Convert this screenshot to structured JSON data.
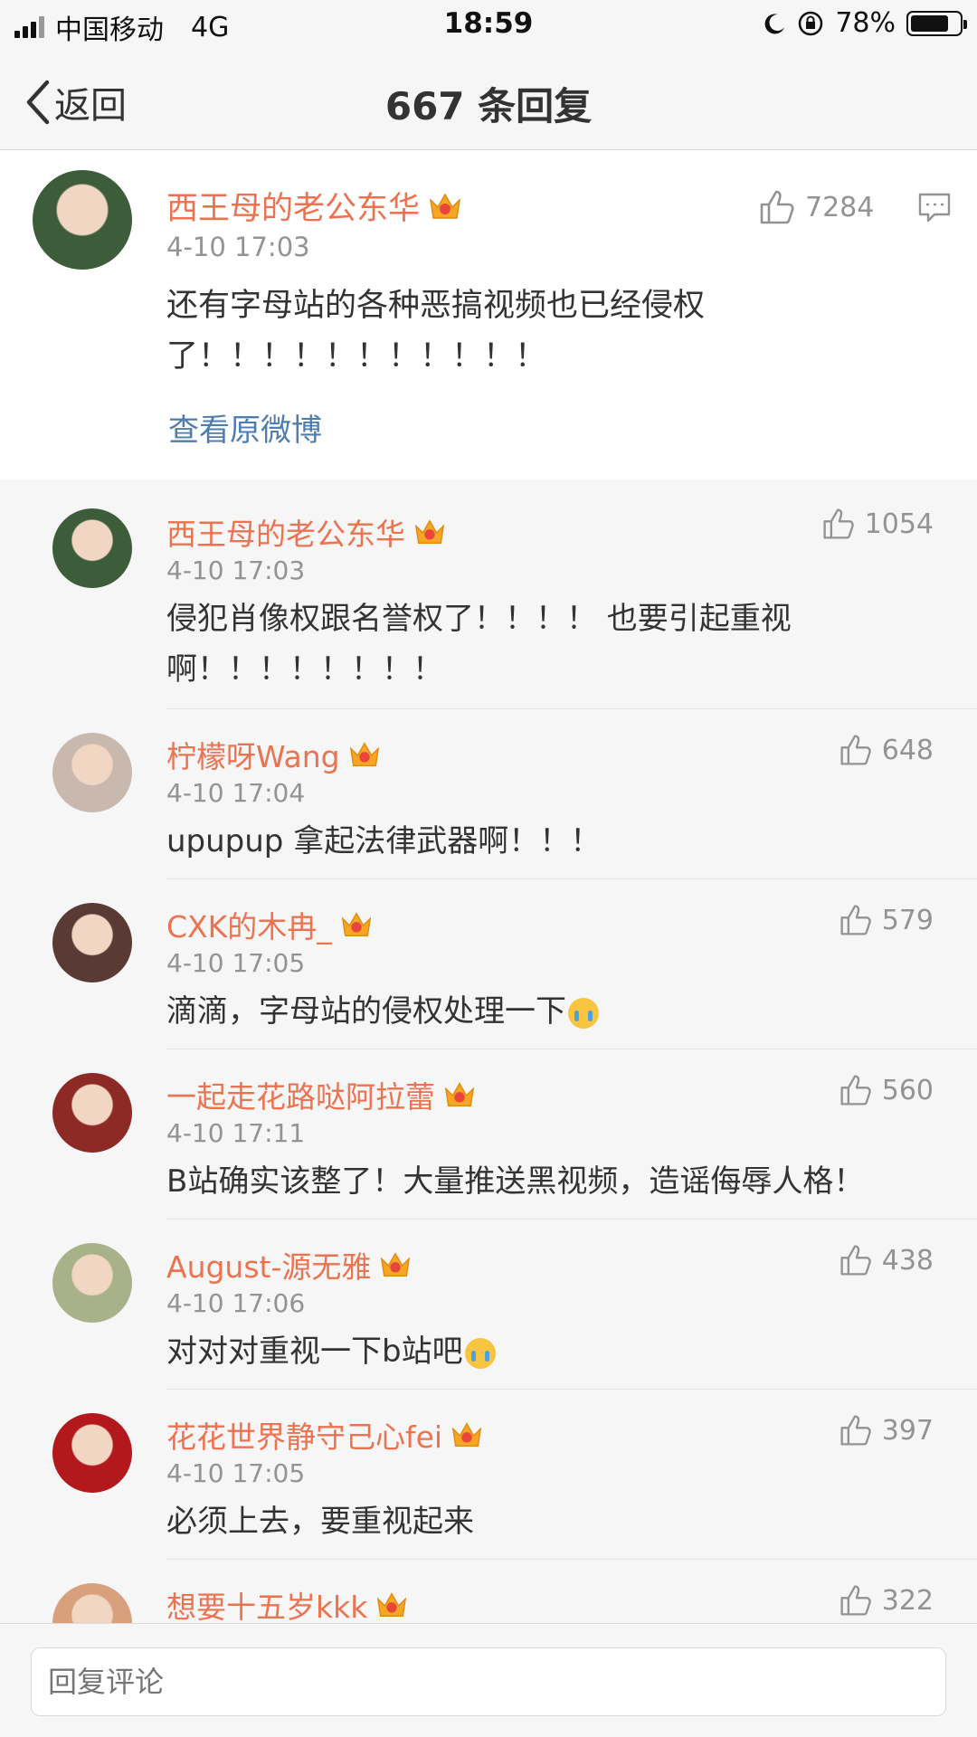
{
  "status_bar": {
    "carrier": "中国移动",
    "network": "4G",
    "time": "18:59",
    "battery": "78%",
    "battery_level": 0.78
  },
  "nav": {
    "back_label": "返回",
    "title": "667 条回复"
  },
  "main_comment": {
    "username": "西王母的老公东华",
    "timestamp": "4-10 17:03",
    "content_line1": "还有字母站的各种恶搞视频也已经侵权",
    "content_line2": "了！！！！！！！！！！！",
    "likes": "7284",
    "view_original": "查看原微博",
    "avatar_color": "#3d5c3a"
  },
  "replies": [
    {
      "username": "西王母的老公东华",
      "timestamp": "4-10 17:03",
      "content": "侵犯肖像权跟名誉权了！！！！ 也要引起重视啊！！！！！！！！",
      "likes": "1054",
      "emoji": false,
      "avatar_color": "#3d5c3a"
    },
    {
      "username": "柠檬呀Wang",
      "timestamp": "4-10 17:04",
      "content": "upupup 拿起法律武器啊！！！",
      "likes": "648",
      "emoji": false,
      "avatar_color": "#c9b8ae"
    },
    {
      "username": "CXK的木冉_",
      "timestamp": "4-10 17:05",
      "content": "滴滴，字母站的侵权处理一下",
      "likes": "579",
      "emoji": true,
      "avatar_color": "#5a3a34"
    },
    {
      "username": "一起走花路哒阿拉蕾",
      "timestamp": "4-10 17:11",
      "content": "B站确实该整了！大量推送黑视频，造谣侮辱人格！",
      "likes": "560",
      "emoji": false,
      "avatar_color": "#8e2a25"
    },
    {
      "username": "August-源无雅",
      "timestamp": "4-10 17:06",
      "content": "对对对重视一下b站吧",
      "likes": "438",
      "emoji": true,
      "avatar_color": "#a8b28a"
    },
    {
      "username": "花花世界静守己心fei",
      "timestamp": "4-10 17:05",
      "content": "必须上去，要重视起来",
      "likes": "397",
      "emoji": false,
      "avatar_color": "#b3181c"
    },
    {
      "username": "想要十五岁kkk",
      "timestamp": "",
      "content": "",
      "likes": "322",
      "emoji": false,
      "avatar_color": "#d9a07e"
    }
  ],
  "bottom_bar": {
    "placeholder": "回复评论"
  },
  "colors": {
    "username": "#eb7350",
    "link": "#507daf",
    "muted": "#939393",
    "crown": "#f5a623"
  }
}
